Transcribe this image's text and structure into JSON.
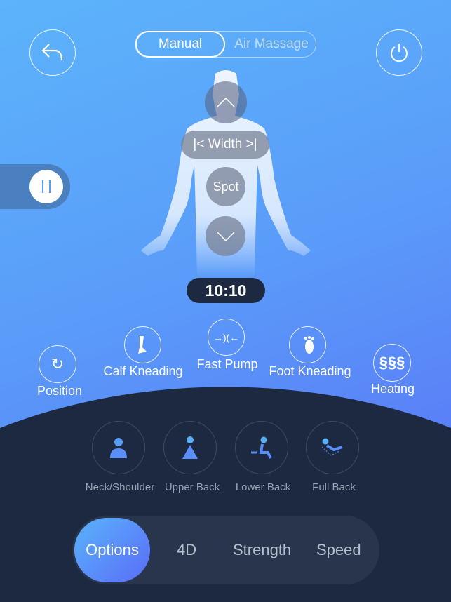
{
  "header": {
    "mode_tabs": [
      {
        "label": "Manual",
        "active": true
      },
      {
        "label": "Air Massage",
        "active": false
      }
    ],
    "back_icon": "back-arrow-icon",
    "power_icon": "power-icon"
  },
  "body_map": {
    "up_icon": "chevron-up-icon",
    "width_label": "Width",
    "spot_label": "Spot",
    "down_icon": "chevron-down-icon"
  },
  "pause_icon": "pause-icon",
  "timer": "10:10",
  "functions": [
    {
      "label": "Position",
      "icon": "recline-icon"
    },
    {
      "label": "Calf Kneading",
      "icon": "leg-icon"
    },
    {
      "label": "Fast Pump",
      "icon": "pump-icon"
    },
    {
      "label": "Foot Kneading",
      "icon": "foot-icon"
    },
    {
      "label": "Heating",
      "icon": "heat-icon"
    }
  ],
  "programs": [
    {
      "label": "Neck/Shoulder",
      "icon": "neck-shoulder-icon"
    },
    {
      "label": "Upper Back",
      "icon": "upper-back-icon"
    },
    {
      "label": "Lower Back",
      "icon": "lower-back-icon"
    },
    {
      "label": "Full Back",
      "icon": "full-back-icon"
    }
  ],
  "bottom_tabs": [
    {
      "label": "Options",
      "active": true
    },
    {
      "label": "4D"
    },
    {
      "label": "Strength"
    },
    {
      "label": "Speed"
    }
  ],
  "colors": {
    "dark_panel": "#1c2940",
    "accent": "#5a8ef9"
  }
}
